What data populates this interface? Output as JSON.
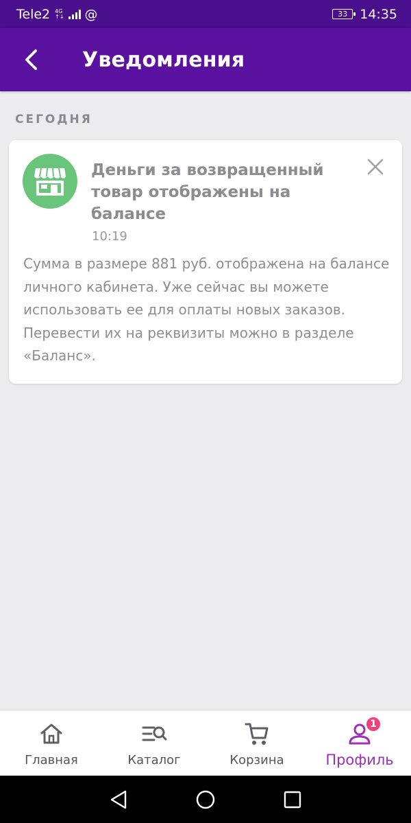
{
  "status_bar": {
    "carrier": "Tele2",
    "network_top": "4G",
    "network_bottom": "↑↓",
    "at_symbol": "@",
    "battery": "33",
    "time": "14:35"
  },
  "header": {
    "title": "Уведомления",
    "back_icon": "chevron-left-icon"
  },
  "section": {
    "label": "СЕГОДНЯ"
  },
  "notification": {
    "avatar_icon": "shop-icon",
    "avatar_color": "#69c57a",
    "title": "Деньги за возвращенный товар отображены на балансе",
    "time": "10:19",
    "body": "Сумма в размере 881 руб. отображена на балансе личного кабинета. Уже сейчас вы можете использовать ее для оплаты новых заказов. Перевести их на реквизиты можно в разделе «Баланс».",
    "close_icon": "close-icon"
  },
  "bottom_nav": {
    "items": [
      {
        "label": "Главная",
        "icon": "home-icon"
      },
      {
        "label": "Каталог",
        "icon": "catalog-search-icon"
      },
      {
        "label": "Корзина",
        "icon": "cart-icon"
      },
      {
        "label": "Профиль",
        "icon": "profile-icon",
        "badge": "1",
        "active": true
      }
    ],
    "active_color": "#9b2fb5",
    "badge_color": "#f0407a"
  },
  "colors": {
    "app_bar": "#5b11a0",
    "status_bar": "#4a0f8d",
    "background": "#ececee"
  }
}
